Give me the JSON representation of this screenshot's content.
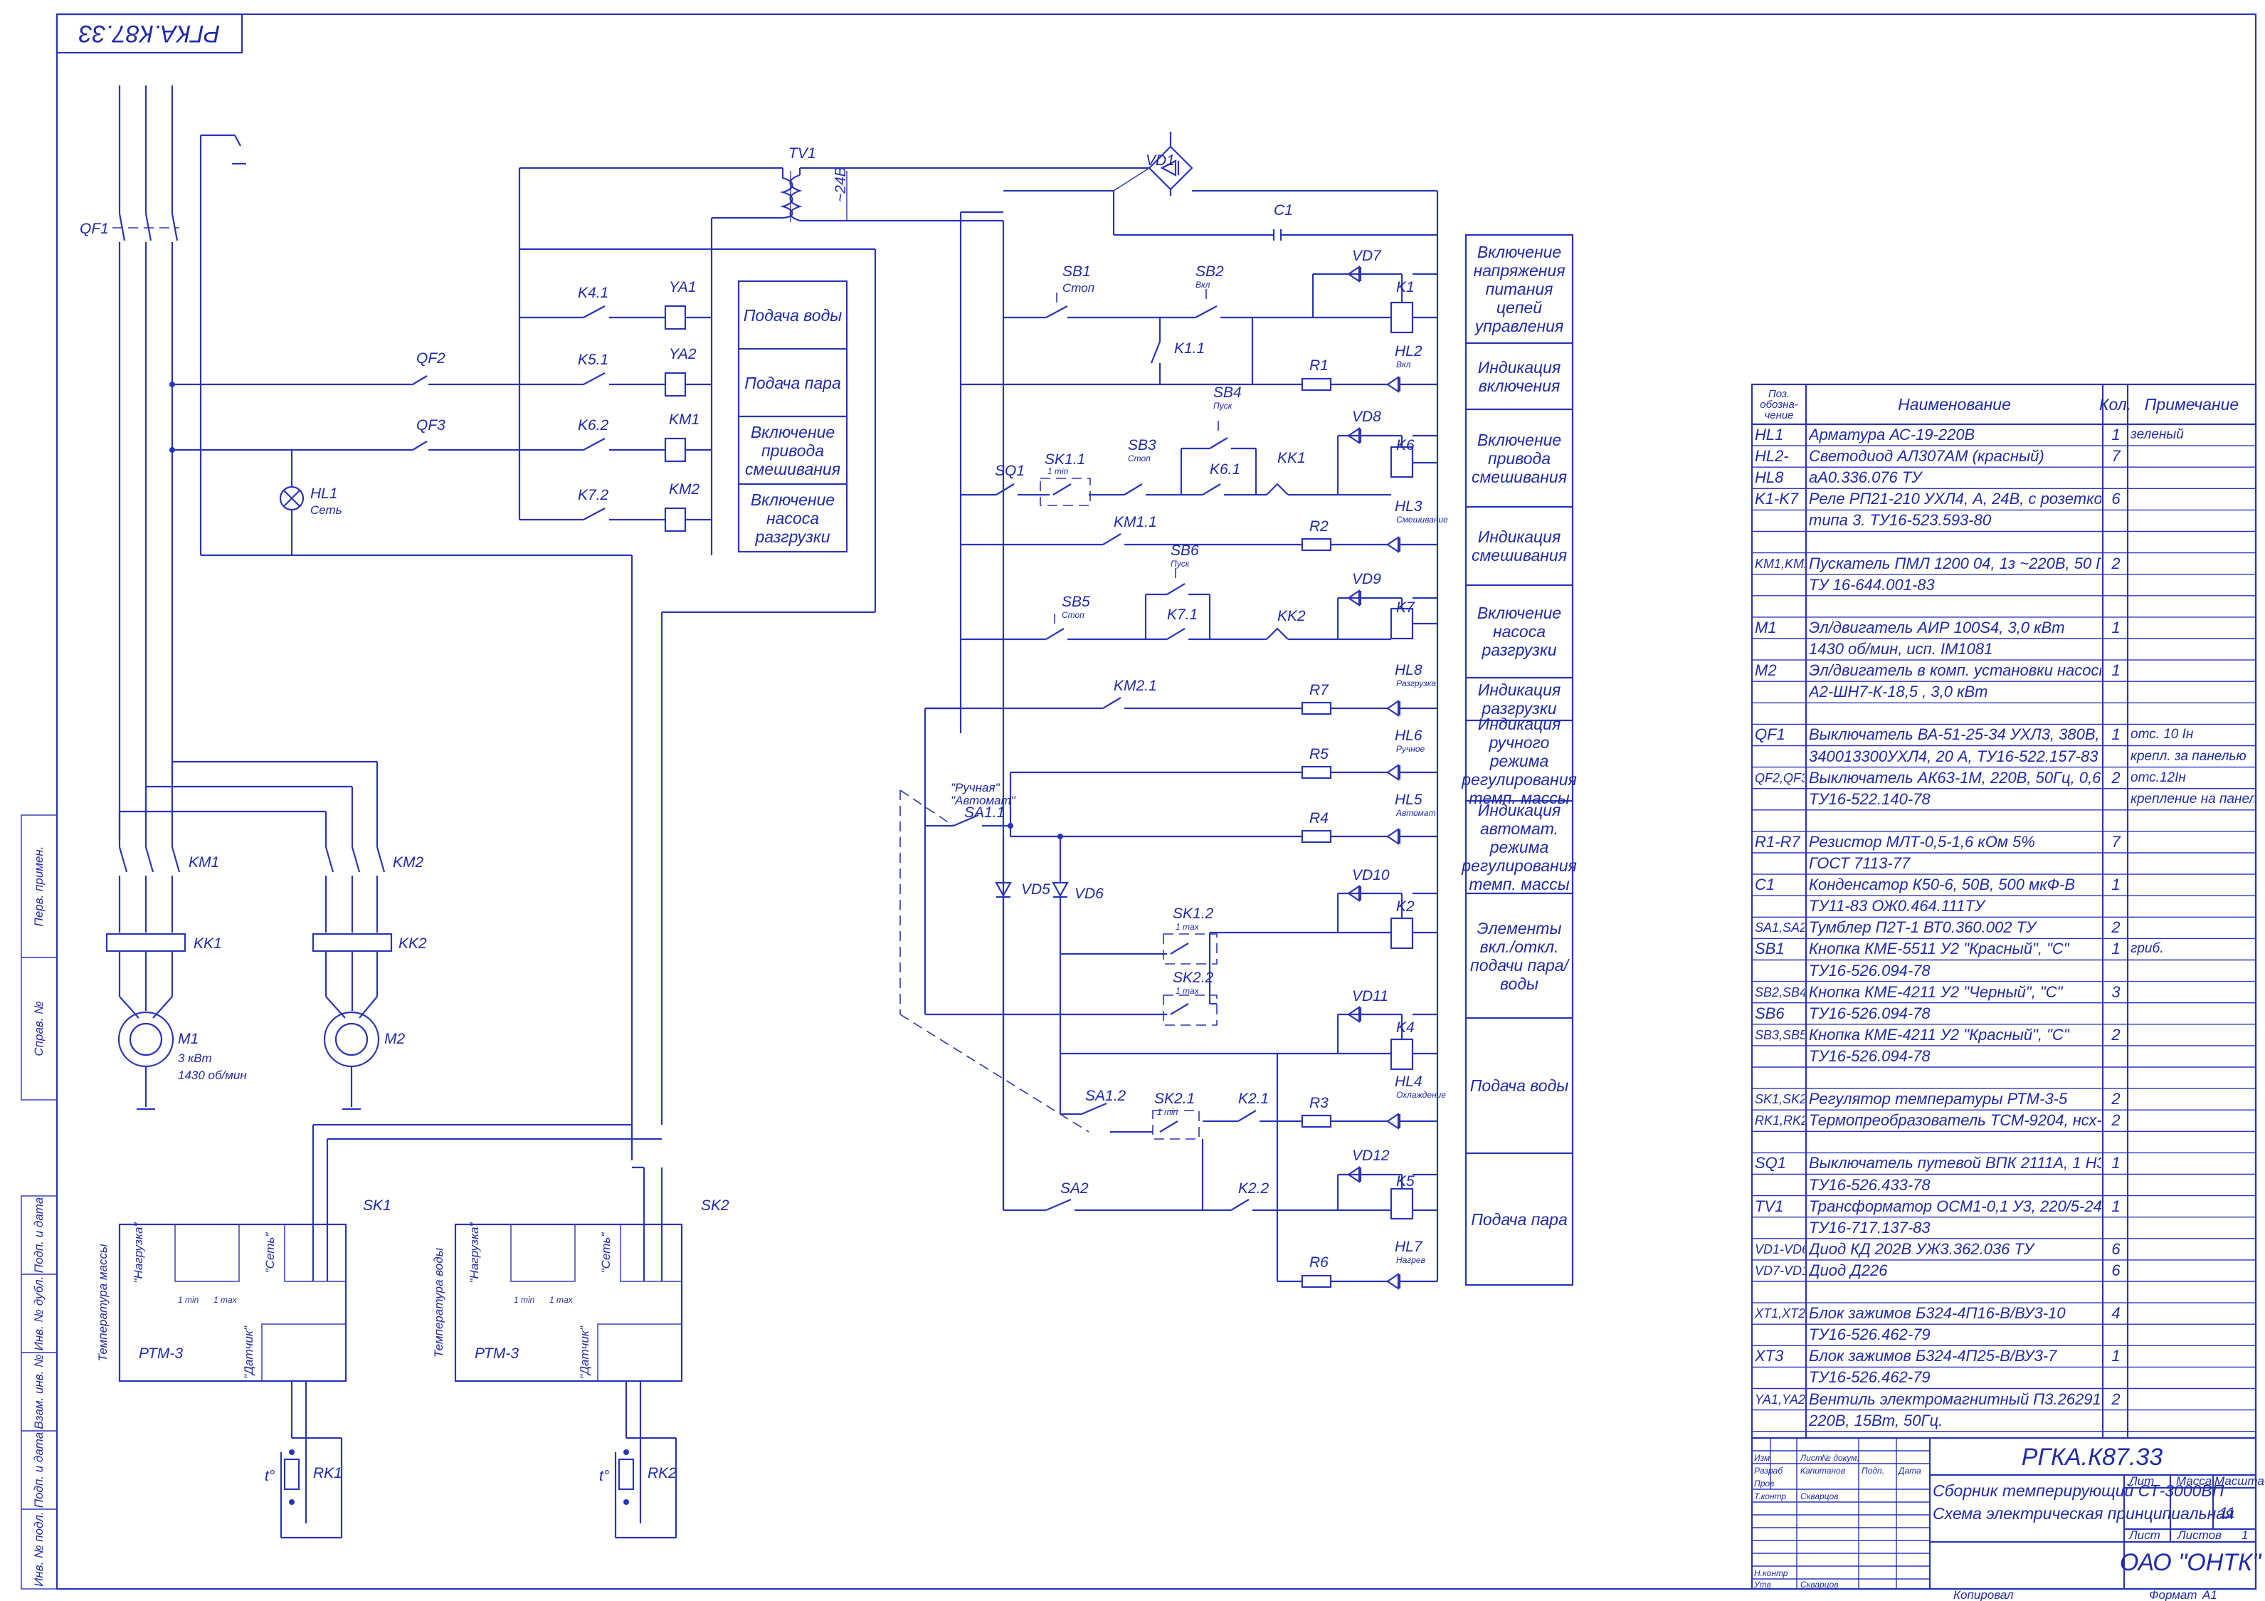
{
  "stamp": {
    "code": "РГКА.К87.33",
    "product": "Сборник темперирующий СТ-3000ВП",
    "doc_name": "Схема электрическая принципиальная",
    "company": "ОАО \"ОНТК\"",
    "sheet_no": "11",
    "sheets_label": "Листов",
    "sheets_count": "1",
    "lit_label": "Лит",
    "mass_label": "Масса",
    "scale_label": "Масштаб",
    "sheet_label": "Лист",
    "rows": [
      {
        "role": "Изм",
        "name": "Лист",
        "extra": "№ докум."
      },
      {
        "role": "Разраб",
        "name": "Капитанов"
      },
      {
        "role": "Пров",
        "name": ""
      },
      {
        "role": "Т.контр",
        "name": "Скварцов"
      },
      {
        "role": "",
        "name": ""
      },
      {
        "role": "Н.контр",
        "name": ""
      },
      {
        "role": "Утв",
        "name": "Скварцов"
      }
    ],
    "sign_label": "Подп.",
    "date_label": "Дата",
    "copied": "Копировал",
    "format": "Формат",
    "format_value": "А1"
  },
  "side_labels": [
    "Перв. примен.",
    "Справ. №",
    "Подп. и дата",
    "Инв. № дубл.",
    "Взам. инв. №",
    "Подп. и дата",
    "Инв. № подл."
  ],
  "function_blocks_left": [
    "Подача воды",
    "Подача пара",
    "Включение привода смешивания",
    "Включение насоса разгрузки"
  ],
  "function_blocks_right": [
    "Включение напряжения питания цепей управления",
    "Индикация включения",
    "Включение привода смешивания",
    "Индикация смешивания",
    "Включение насоса разгрузки",
    "Индикация разгрузки",
    "Индикация ручного режима регулирования темп. массы",
    "Индикация автомат. режима регулирования темп. массы",
    "Элементы вкл./откл. подачи пара/воды",
    "Подача воды",
    "Подача пара"
  ],
  "bom": {
    "headers": [
      "Поз. обозна-чение",
      "Наименование",
      "Кол.",
      "Примечание"
    ],
    "rows": [
      [
        "HL1",
        "Арматура АС-19-220В",
        "1",
        "зеленый"
      ],
      [
        "HL2-",
        "Светодиод АЛ307АМ (красный)",
        "7",
        ""
      ],
      [
        "HL8",
        "аА0.336.076 ТУ",
        "",
        ""
      ],
      [
        "K1-K7",
        "Реле РП21-210 УХЛ4, А, 24В, с розеткой",
        "6",
        ""
      ],
      [
        "",
        "типа 3. ТУ16-523.593-80",
        "",
        ""
      ],
      [
        "",
        "",
        "",
        ""
      ],
      [
        "KM1,KM2",
        "Пускатель ПМЛ 1200 04, 1з ~220В, 50 Гц",
        "2",
        ""
      ],
      [
        "",
        "ТУ 16-644.001-83",
        "",
        ""
      ],
      [
        "",
        "",
        "",
        ""
      ],
      [
        "M1",
        "Эл/двигатель АИР 100S4, 3,0 кВт",
        "1",
        ""
      ],
      [
        "",
        "1430 об/мин, исп. IM1081",
        "",
        ""
      ],
      [
        "M2",
        "Эл/двигатель в комп. установки насосной",
        "1",
        ""
      ],
      [
        "",
        "А2-ШН7-К-18,5 , 3,0 кВт",
        "",
        ""
      ],
      [
        "",
        "",
        "",
        ""
      ],
      [
        "QF1",
        "Выключатель ВА-51-25-34 УХЛ3, 380В,",
        "1",
        "отс. 10 Iн"
      ],
      [
        "",
        "340013300УХЛ4, 20 А, ТУ16-522.157-83",
        "",
        "крепл. за панелью"
      ],
      [
        "QF2,QF3",
        "Выключатель АК63-1М, 220В, 50Гц, 0,6 А,",
        "2",
        "отс.12Iн"
      ],
      [
        "",
        "ТУ16-522.140-78",
        "",
        "крепление на панели"
      ],
      [
        "",
        "",
        "",
        ""
      ],
      [
        "R1-R7",
        "Резистор МЛТ-0,5-1,6 кОм 5%",
        "7",
        ""
      ],
      [
        "",
        "ГОСТ 7113-77",
        "",
        ""
      ],
      [
        "C1",
        "Конденсатор К50-6, 50В, 500 мкФ-В",
        "1",
        ""
      ],
      [
        "",
        "ТУ11-83 ОЖ0.464.111ТУ",
        "",
        ""
      ],
      [
        "SA1,SA2",
        "Тумблер П2Т-1 ВТ0.360.002 ТУ",
        "2",
        ""
      ],
      [
        "SB1",
        "Кнопка КМЕ-5511 У2 \"Красный\", \"С\"",
        "1",
        "гриб."
      ],
      [
        "",
        "ТУ16-526.094-78",
        "",
        ""
      ],
      [
        "SB2,SB4",
        "Кнопка КМЕ-4211 У2 \"Черный\", \"С\"",
        "3",
        ""
      ],
      [
        "SB6",
        "ТУ16-526.094-78",
        "",
        ""
      ],
      [
        "SB3,SB5",
        "Кнопка КМЕ-4211 У2 \"Красный\", \"С\"",
        "2",
        ""
      ],
      [
        "",
        "ТУ16-526.094-78",
        "",
        ""
      ],
      [
        "",
        "",
        "",
        ""
      ],
      [
        "SK1,SK2",
        "Регулятор температуры РТМ-3-5",
        "2",
        ""
      ],
      [
        "RK1,RK2",
        "Термопреобразователь ТСМ-9204, нсх-50М",
        "2",
        ""
      ],
      [
        "",
        "",
        "",
        ""
      ],
      [
        "SQ1",
        "Выключатель путевой ВПК 2111А, 1 НЗ, 1 НО",
        "1",
        ""
      ],
      [
        "",
        "ТУ16-526.433-78",
        "",
        ""
      ],
      [
        "TV1",
        "Трансформатор ОСМ1-0,1 У3, 220/5-24",
        "1",
        ""
      ],
      [
        "",
        "ТУ16-717.137-83",
        "",
        ""
      ],
      [
        "VD1-VD6",
        "Диод КД 202В УЖ3.362.036 ТУ",
        "6",
        ""
      ],
      [
        "VD7-VD12",
        "Диод Д226",
        "6",
        ""
      ],
      [
        "",
        "",
        "",
        ""
      ],
      [
        "XT1,XT2",
        "Блок зажимов Б324-4П16-В/ВУ3-10",
        "4",
        ""
      ],
      [
        "",
        "ТУ16-526.462-79",
        "",
        ""
      ],
      [
        "XT3",
        "Блок зажимов Б324-4П25-В/ВУ3-7",
        "1",
        ""
      ],
      [
        "",
        "ТУ16-526.462-79",
        "",
        ""
      ],
      [
        "YA1,YA2",
        "Вентиль электромагнитный П3.26291-015М",
        "2",
        ""
      ],
      [
        "",
        "220В, 15Вт, 50Гц.",
        "",
        ""
      ]
    ]
  },
  "labels": {
    "qf1": "QF1",
    "qf2": "QF2",
    "qf3": "QF3",
    "tv1": "TV1",
    "v24": "~24В",
    "vd1": "VD1",
    "c1": "C1",
    "hl1": "HL1",
    "hl1_sub": "Сеть",
    "k41": "K4.1",
    "k51": "K5.1",
    "k62": "K6.2",
    "k72": "K7.2",
    "ya1": "YA1",
    "ya2": "YA2",
    "km1": "KM1",
    "km2": "KM2",
    "kk1": "KK1",
    "kk2": "KK2",
    "m1": "M1",
    "m2": "M2",
    "m1_power": "3 кВт",
    "m1_speed": "1430 об/мин",
    "sb1": "SB1",
    "sb1_sub": "Стоп",
    "sb2": "SB2",
    "sb2_sub": "Вкл",
    "k11": "K1.1",
    "k1": "K1",
    "k2": "K2",
    "k4": "K4",
    "k5": "K5",
    "k6": "K6",
    "k7": "K7",
    "vd7": "VD7",
    "vd8": "VD8",
    "vd9": "VD9",
    "vd10": "VD10",
    "vd11": "VD11",
    "vd12": "VD12",
    "r1": "R1",
    "r2": "R2",
    "r3": "R3",
    "r4": "R4",
    "r5": "R5",
    "r6": "R6",
    "r7": "R7",
    "hl2": "HL2",
    "hl2_sub": "Вкл",
    "hl3": "HL3",
    "hl3_sub": "Смешивание",
    "hl4": "HL4",
    "hl4_sub": "Охлаждение",
    "hl5": "HL5",
    "hl5_sub": "Автомат",
    "hl6": "HL6",
    "hl6_sub": "Ручное",
    "hl7": "HL7",
    "hl7_sub": "Нагрев",
    "hl8": "HL8",
    "hl8_sub": "Разгрузка",
    "sb3": "SB3",
    "sb3_sub": "Стоп",
    "sb4": "SB4",
    "sb4_sub": "Пуск",
    "sb5": "SB5",
    "sb5_sub": "Стоп",
    "sb6": "SB6",
    "sb6_sub": "Пуск",
    "sq1": "SQ1",
    "sk11": "SK1.1",
    "sk11_sub": "1 min",
    "k61": "K6.1",
    "kk1c": "KK1",
    "km11": "KM1.1",
    "k71": "K7.1",
    "kk2c": "KK2",
    "km21": "KM2.1",
    "sa11": "SA1.1",
    "sa12": "SA1.2",
    "sa2": "SA2",
    "manual": "\"Ручная\"",
    "auto": "\"Автомат\"",
    "vd5": "VD5",
    "vd6": "VD6",
    "sk12": "SK1.2",
    "sk12_sub": "1 max",
    "sk22": "SK2.2",
    "sk22_sub": "1 max",
    "sk21": "SK2.1",
    "sk21_sub": "1 min",
    "k21": "K2.1",
    "k22": "K2.2",
    "sk1": "SK1",
    "sk2": "SK2",
    "rk1": "RK1",
    "rk2": "RK2",
    "rtm": "РТМ-3",
    "sk1_side": "Температура массы",
    "sk2_side": "Температура воды",
    "load": "\"Нагрузка\"",
    "net": "\"Сеть\"",
    "sensor": "\"Датчик\"",
    "tmin": "1 min",
    "tmax": "1 max",
    "t_sym": "t°"
  }
}
